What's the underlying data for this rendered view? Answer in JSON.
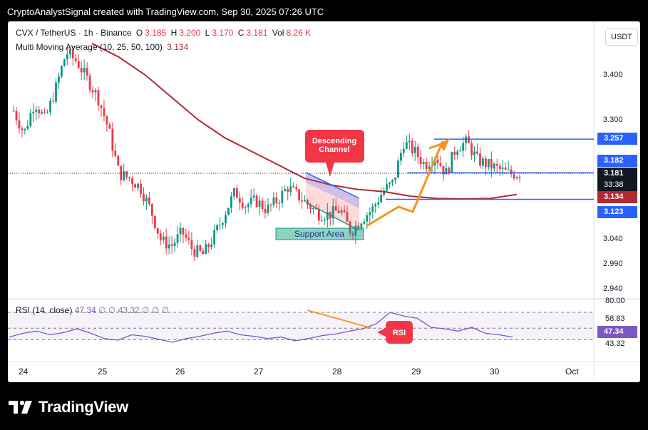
{
  "caption": "CryptoAnalystSignal created with TradingView.com, Sep 30, 2025 07:26 UTC",
  "symbol_line": {
    "symbol": "CVX / TetherUS · 1h · Binance",
    "o_label": "O",
    "o": "3.185",
    "h_label": "H",
    "h": "3.200",
    "l_label": "L",
    "l": "3.170",
    "c_label": "C",
    "c": "3.181",
    "vol_label": "Vol",
    "vol": "8.26 K"
  },
  "ma_line": {
    "label": "Multi Moving Average (10, 25, 50, 100)",
    "value": "3.134"
  },
  "currency": "USDT",
  "price_axis": {
    "ticks": [
      "3.400",
      "3.300",
      "3.040",
      "2.990",
      "2.940"
    ]
  },
  "price_badges": [
    {
      "value": "3.257",
      "color": "#2962ff"
    },
    {
      "value": "3.182",
      "color": "#2962ff"
    },
    {
      "value": "3.181",
      "color": "#131722"
    },
    {
      "value": "33:38",
      "color": "#131722"
    },
    {
      "value": "3.134",
      "color": "#b22833"
    },
    {
      "value": "3.123",
      "color": "#2962ff"
    }
  ],
  "annotations": {
    "descending_channel": "Descending\nChannel",
    "support_area": "Support Area",
    "rsi_callout": "RSI"
  },
  "rsi": {
    "label": "RSI (14, close)",
    "value": "47.34",
    "ma_value": "43.32",
    "placeholders": [
      "∅",
      "∅",
      "∅",
      "∅",
      "∅"
    ],
    "levels": [
      "80.00",
      "58.83",
      "43.32"
    ],
    "current_badge": "47.34"
  },
  "dates": [
    "24",
    "25",
    "26",
    "27",
    "28",
    "29",
    "30",
    "Oct"
  ],
  "footer": {
    "brand": "TradingView"
  },
  "colors": {
    "up": "#089981",
    "down": "#f23645",
    "ma": "#b22833",
    "level": "#2962ff",
    "arrow": "#f7931a",
    "rsi": "#7e57c2"
  },
  "chart_data": {
    "type": "candlestick",
    "title": "CVX / TetherUS · 1h · Binance",
    "ylim": [
      2.92,
      3.46
    ],
    "x": [
      "24",
      "25",
      "26",
      "27",
      "28",
      "29",
      "30",
      "Oct"
    ],
    "close_path": [
      3.32,
      3.27,
      3.34,
      3.3,
      3.37,
      3.45,
      3.43,
      3.39,
      3.35,
      3.28,
      3.18,
      3.17,
      3.15,
      3.1,
      3.03,
      3.02,
      3.05,
      3.01,
      3.0,
      3.04,
      3.09,
      3.14,
      3.11,
      3.12,
      3.1,
      3.12,
      3.15,
      3.13,
      3.11,
      3.09,
      3.09,
      3.1,
      3.05,
      3.08,
      3.1,
      3.14,
      3.16,
      3.25,
      3.23,
      3.2,
      3.22,
      3.18,
      3.24,
      3.25,
      3.21,
      3.2,
      3.19,
      3.18,
      3.18
    ],
    "moving_average": [
      3.47,
      3.44,
      3.4,
      3.35,
      3.3,
      3.26,
      3.23,
      3.2,
      3.17,
      3.155,
      3.145,
      3.14,
      3.13,
      3.125,
      3.124,
      3.125,
      3.134
    ],
    "levels": [
      3.257,
      3.182,
      3.123
    ],
    "rsi_series": [
      47,
      52,
      55,
      50,
      53,
      58,
      52,
      45,
      43,
      50,
      48,
      44,
      40,
      45,
      48,
      52,
      55,
      50,
      48,
      45,
      47,
      42,
      45,
      49,
      51,
      55,
      58,
      65,
      80,
      75,
      72,
      60,
      58,
      55,
      60,
      52,
      50,
      47
    ]
  }
}
